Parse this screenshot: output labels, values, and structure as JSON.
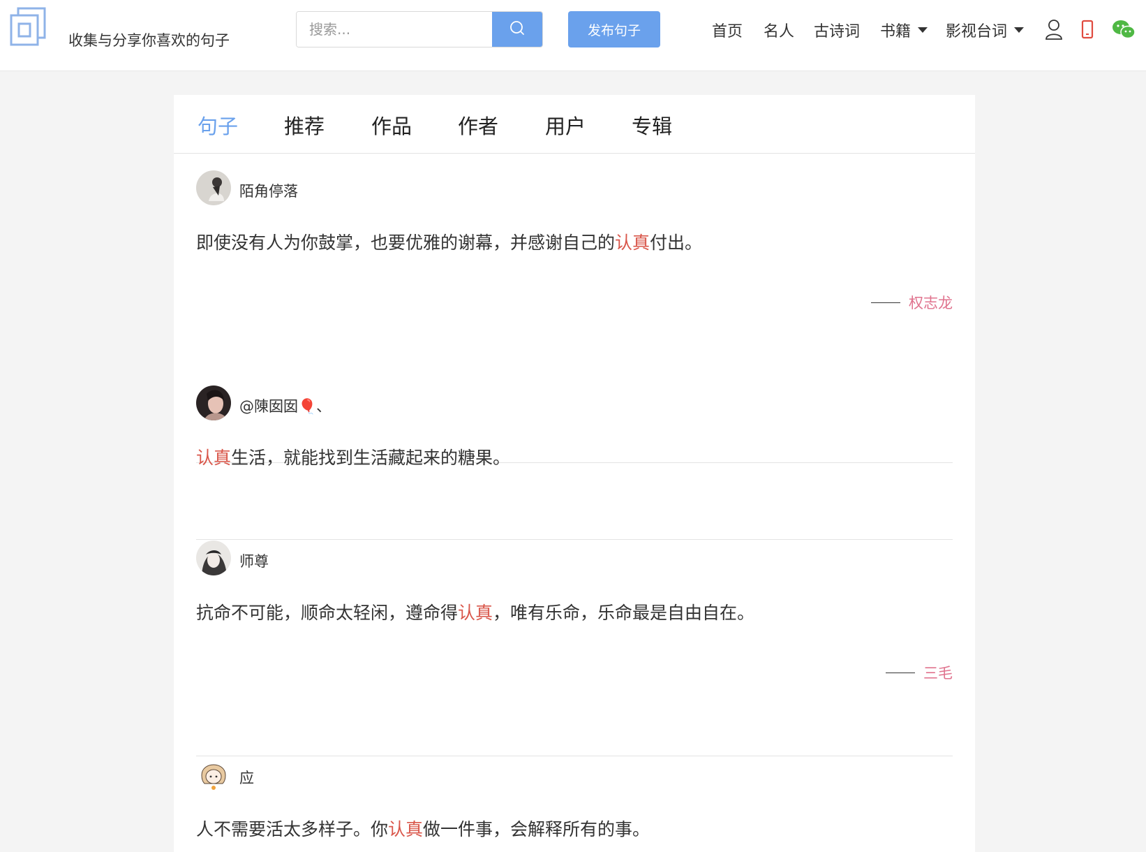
{
  "header": {
    "tagline": "收集与分享你喜欢的句子",
    "search_placeholder": "搜索...",
    "publish_label": "发布句子",
    "nav": {
      "home": "首页",
      "celebrities": "名人",
      "poetry": "古诗词",
      "books": "书籍",
      "movie_lines": "影视台词"
    },
    "icons": [
      "user-icon",
      "mobile-icon",
      "wechat-icon"
    ],
    "accent_color": "#6aa1ec"
  },
  "tabs": [
    {
      "label": "句子",
      "active": true
    },
    {
      "label": "推荐",
      "active": false
    },
    {
      "label": "作品",
      "active": false
    },
    {
      "label": "作者",
      "active": false
    },
    {
      "label": "用户",
      "active": false
    },
    {
      "label": "专辑",
      "active": false
    }
  ],
  "highlight_color": "#d9564a",
  "author_color": "#e0738e",
  "posts": [
    {
      "username": "陌角停落",
      "content_before": "即使没有人为你鼓掌，也要优雅的谢幕，并感谢自己的",
      "highlight": "认真",
      "content_after": "付出。",
      "author": "权志龙"
    },
    {
      "username": "@陳囡囡🎈、",
      "content_before": "",
      "highlight": "认真",
      "content_after": "生活，就能找到生活藏起来的糖果。",
      "author": ""
    },
    {
      "username": "师尊",
      "content_before": "抗命不可能，顺命太轻闲，遵命得",
      "highlight": "认真",
      "content_after": "，唯有乐命，乐命最是自由自在。",
      "author": "三毛"
    },
    {
      "username": "应",
      "content_before": "人不需要活太多样子。你",
      "highlight": "认真",
      "content_after": "做一件事，会解释所有的事。",
      "author": ""
    }
  ]
}
